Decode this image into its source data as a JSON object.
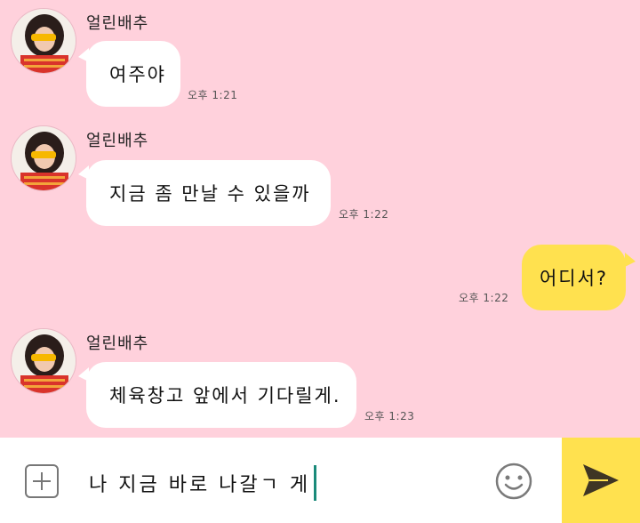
{
  "messages": [
    {
      "sender": "얼린배추",
      "text": "여주야",
      "time": "오후 1:21"
    },
    {
      "sender": "얼린배추",
      "text": "지금 좀 만날 수 있을까",
      "time": "오후 1:22"
    },
    {
      "sender": "me",
      "text": "어디서?",
      "time": "오후 1:22"
    },
    {
      "sender": "얼린배추",
      "text": "체육창고 앞에서 기다릴게.",
      "time": "오후 1:23"
    }
  ],
  "composer": {
    "value": "나 지금 바로 나갈ㄱ 게"
  },
  "icons": {
    "attach": "plus-box-icon",
    "emoji": "smiley-icon",
    "send": "paper-plane-icon"
  },
  "colors": {
    "chat_background": "#ffd1dc",
    "my_bubble": "#ffe14f",
    "other_bubble": "#ffffff",
    "send_button": "#ffe14f",
    "caret": "#1a8a7a"
  }
}
